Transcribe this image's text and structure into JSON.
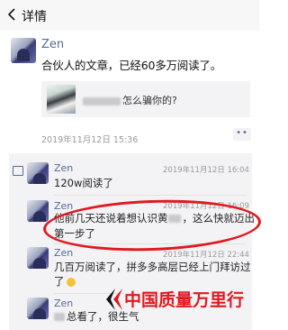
{
  "header": {
    "title": "详情"
  },
  "post": {
    "author": "Zen",
    "text": "合伙人的文章，已经60多万阅读了。",
    "link_title": "怎么骗你的?",
    "time": "2019年11月12日 15:36",
    "more": "••"
  },
  "comments": [
    {
      "name": "Zen",
      "time": "2019年11月12日 16:04",
      "text": "120w阅读了"
    },
    {
      "name": "Zen",
      "time": "2019年11月12日 16:09",
      "text_line1": "他前几天还说着想认识黄",
      "text_line1_end": "，这么快就迈出",
      "text_line2": "第一步了"
    },
    {
      "name": "Zen",
      "time": "2019年11月12日 22:44",
      "text_line1": "几百万阅读了，拼多多高层已经上门拜访过",
      "text_line2": "了"
    },
    {
      "name": "Zen",
      "time": "",
      "text_end": "总看了，很生气"
    }
  ],
  "watermark": {
    "text": "中国质量万里行"
  },
  "colors": {
    "highlight": "#e0191f",
    "name_blue": "#576b95"
  }
}
